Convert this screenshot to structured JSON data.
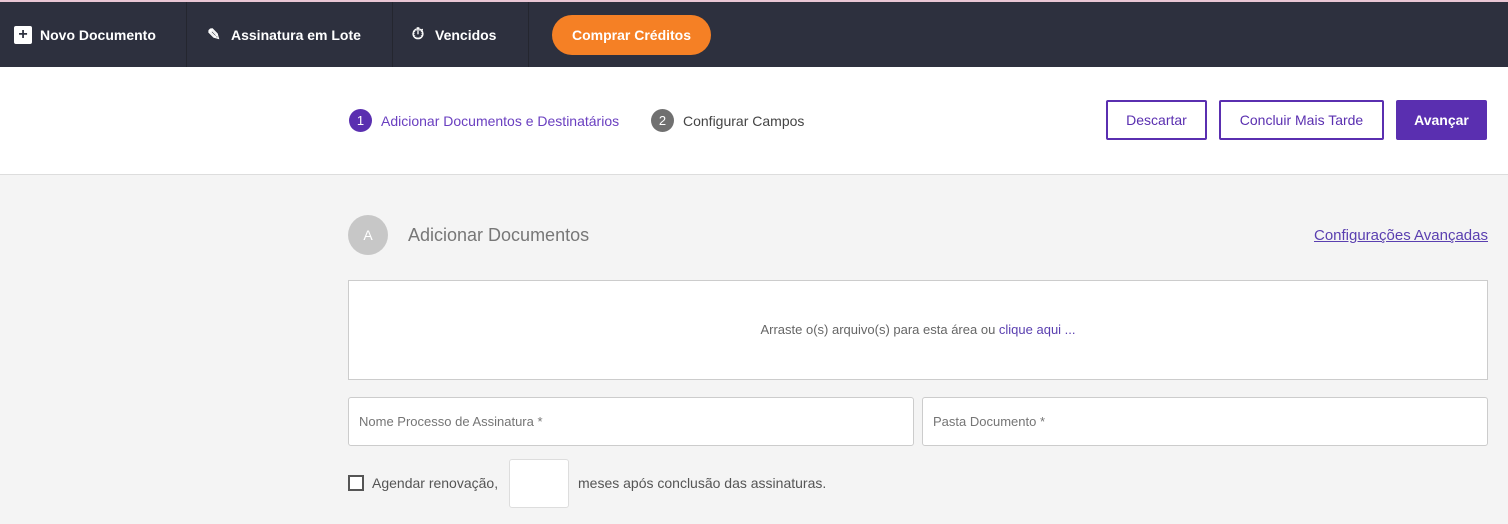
{
  "topbar": {
    "items": [
      {
        "label": "Novo Documento",
        "icon": "plus-square-icon"
      },
      {
        "label": "Assinatura em Lote",
        "icon": "pen-batch-icon"
      },
      {
        "label": "Vencidos",
        "icon": "stopwatch-icon"
      }
    ],
    "buy_label": "Comprar Créditos"
  },
  "steps": [
    {
      "num": "1",
      "label": "Adicionar Documentos e Destinatários"
    },
    {
      "num": "2",
      "label": "Configurar Campos"
    }
  ],
  "actions": {
    "discard": "Descartar",
    "later": "Concluir Mais Tarde",
    "next": "Avançar"
  },
  "section": {
    "badge": "A",
    "title": "Adicionar Documentos",
    "advanced": "Configurações Avançadas"
  },
  "dropzone": {
    "text": "Arraste o(s) arquivo(s) para esta área ou ",
    "link": "clique aqui ..."
  },
  "form": {
    "process_placeholder": "Nome Processo de Assinatura *",
    "folder_placeholder": "Pasta Documento *",
    "schedule_label": "Agendar renovação,",
    "months_value": "",
    "months_suffix": "meses após conclusão das assinaturas."
  },
  "colors": {
    "topbar": "#2d303e",
    "accent": "#5a2fb0",
    "buy": "#f58025"
  }
}
